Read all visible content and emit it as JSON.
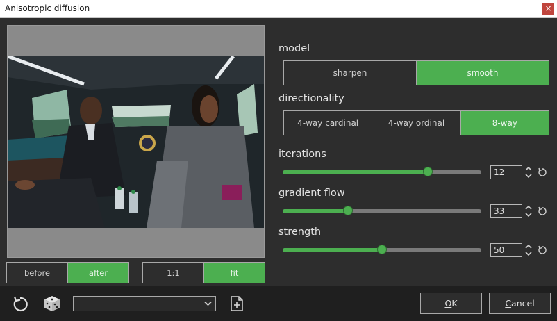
{
  "window": {
    "title": "Anisotropic diffusion",
    "close_glyph": "×"
  },
  "view_toggle": {
    "before": "before",
    "after": "after",
    "selected": "after"
  },
  "zoom_toggle": {
    "one_to_one": "1:1",
    "fit": "fit",
    "selected": "fit"
  },
  "model": {
    "label": "model",
    "options": [
      "sharpen",
      "smooth"
    ],
    "selected": "smooth"
  },
  "directionality": {
    "label": "directionality",
    "options": [
      "4-way cardinal",
      "4-way ordinal",
      "8-way"
    ],
    "selected": "8-way"
  },
  "iterations": {
    "label": "iterations",
    "value": "12",
    "fraction": 0.73
  },
  "gradient_flow": {
    "label": "gradient flow",
    "value": "33",
    "fraction": 0.33
  },
  "strength": {
    "label": "strength",
    "value": "50",
    "fraction": 0.5
  },
  "preset": {
    "value": ""
  },
  "buttons": {
    "ok_mnemonic": "O",
    "ok_rest": "K",
    "cancel_mnemonic": "C",
    "cancel_rest": "ancel"
  },
  "icons": [
    "reset-icon",
    "dice-icon",
    "new-preset-icon",
    "chevron-down-icon",
    "spin-arrows-icon",
    "reset-slider-icon"
  ],
  "colors": {
    "accent": "#4caf50",
    "background": "#2d2d2d",
    "bottom_bar": "#1f1f1f"
  }
}
